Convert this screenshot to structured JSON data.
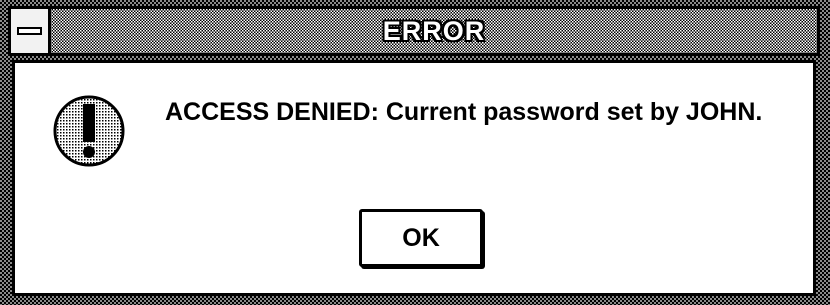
{
  "dialog": {
    "title": "ERROR",
    "message": "ACCESS DENIED: Current password set by JOHN.",
    "ok_label": "OK"
  },
  "icons": {
    "system_menu": "system-menu-icon",
    "alert": "exclamation-icon"
  },
  "colors": {
    "frame_dither": "#8a8a8a",
    "text": "#000000",
    "background": "#ffffff"
  }
}
